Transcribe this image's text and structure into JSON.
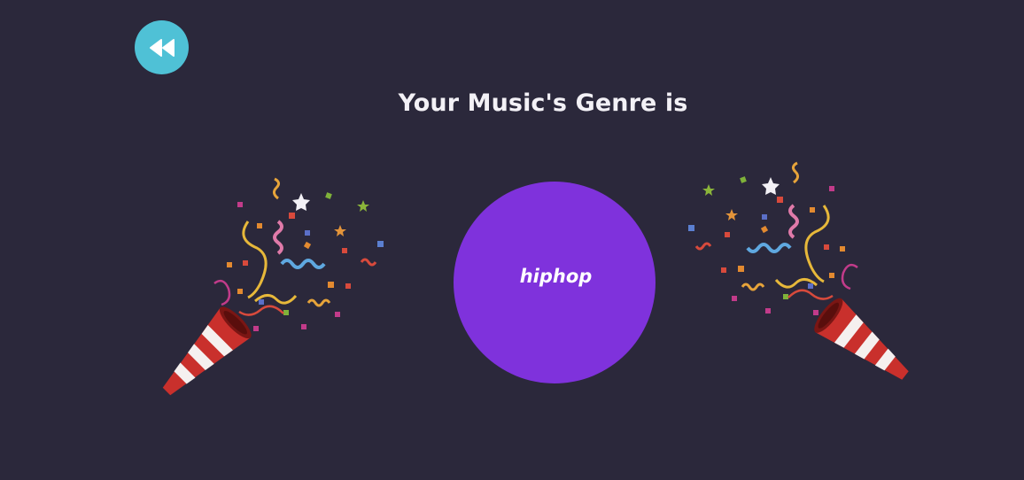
{
  "header": {
    "back_icon": "rewind-icon",
    "back_button_color": "#4fc1d6"
  },
  "main": {
    "title": "Your Music's Genre is",
    "genre": "hiphop",
    "genre_circle_color": "#7f32dc",
    "decorations": {
      "left_icon": "party-popper-icon",
      "right_icon": "party-popper-icon"
    }
  },
  "colors": {
    "background": "#2b283b",
    "title_text": "#f3f1f6"
  }
}
